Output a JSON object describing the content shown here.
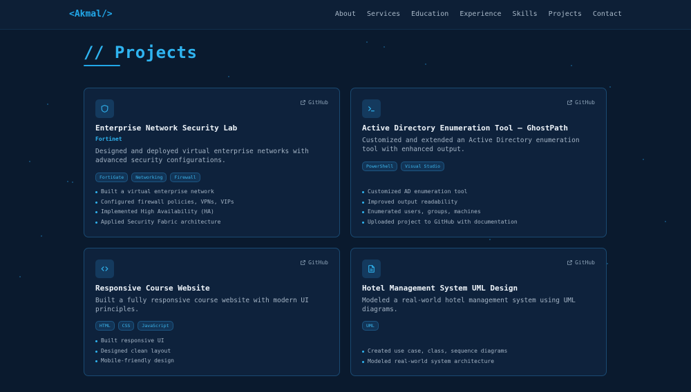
{
  "nav": {
    "logo": "<Akmal/>",
    "links": [
      "About",
      "Services",
      "Education",
      "Experience",
      "Skills",
      "Projects",
      "Contact"
    ]
  },
  "section": {
    "title": "// Projects"
  },
  "github_label": "GitHub",
  "projects": [
    {
      "icon": "shield-icon",
      "title": "Enterprise Network Security Lab",
      "org": "Fortinet",
      "description": "Designed and deployed virtual enterprise networks with advanced security configurations.",
      "tags": [
        "FortiGate",
        "Networking",
        "Firewall"
      ],
      "bullets": [
        "Built a virtual enterprise network",
        "Configured firewall policies, VPNs, VIPs",
        "Implemented High Availability (HA)",
        "Applied Security Fabric architecture"
      ]
    },
    {
      "icon": "terminal-icon",
      "title": "Active Directory Enumeration Tool – GhostPath",
      "org": "",
      "description": "Customized and extended an Active Directory enumeration tool with enhanced output.",
      "tags": [
        "PowerShell",
        "Visual Studio"
      ],
      "bullets": [
        "Customized AD enumeration tool",
        "Improved output readability",
        "Enumerated users, groups, machines",
        "Uploaded project to GitHub with documentation"
      ]
    },
    {
      "icon": "code-icon",
      "title": "Responsive Course Website",
      "org": "",
      "description": "Built a fully responsive course website with modern UI principles.",
      "tags": [
        "HTML",
        "CSS",
        "JavaScript"
      ],
      "bullets": [
        "Built responsive UI",
        "Designed clean layout",
        "Mobile-friendly design"
      ]
    },
    {
      "icon": "document-icon",
      "title": "Hotel Management System UML Design",
      "org": "",
      "description": "Modeled a real-world hotel management system using UML diagrams.",
      "tags": [
        "UML"
      ],
      "bullets": [
        "Created use case, class, sequence diagrams",
        "Modeled real-world system architecture"
      ]
    }
  ]
}
